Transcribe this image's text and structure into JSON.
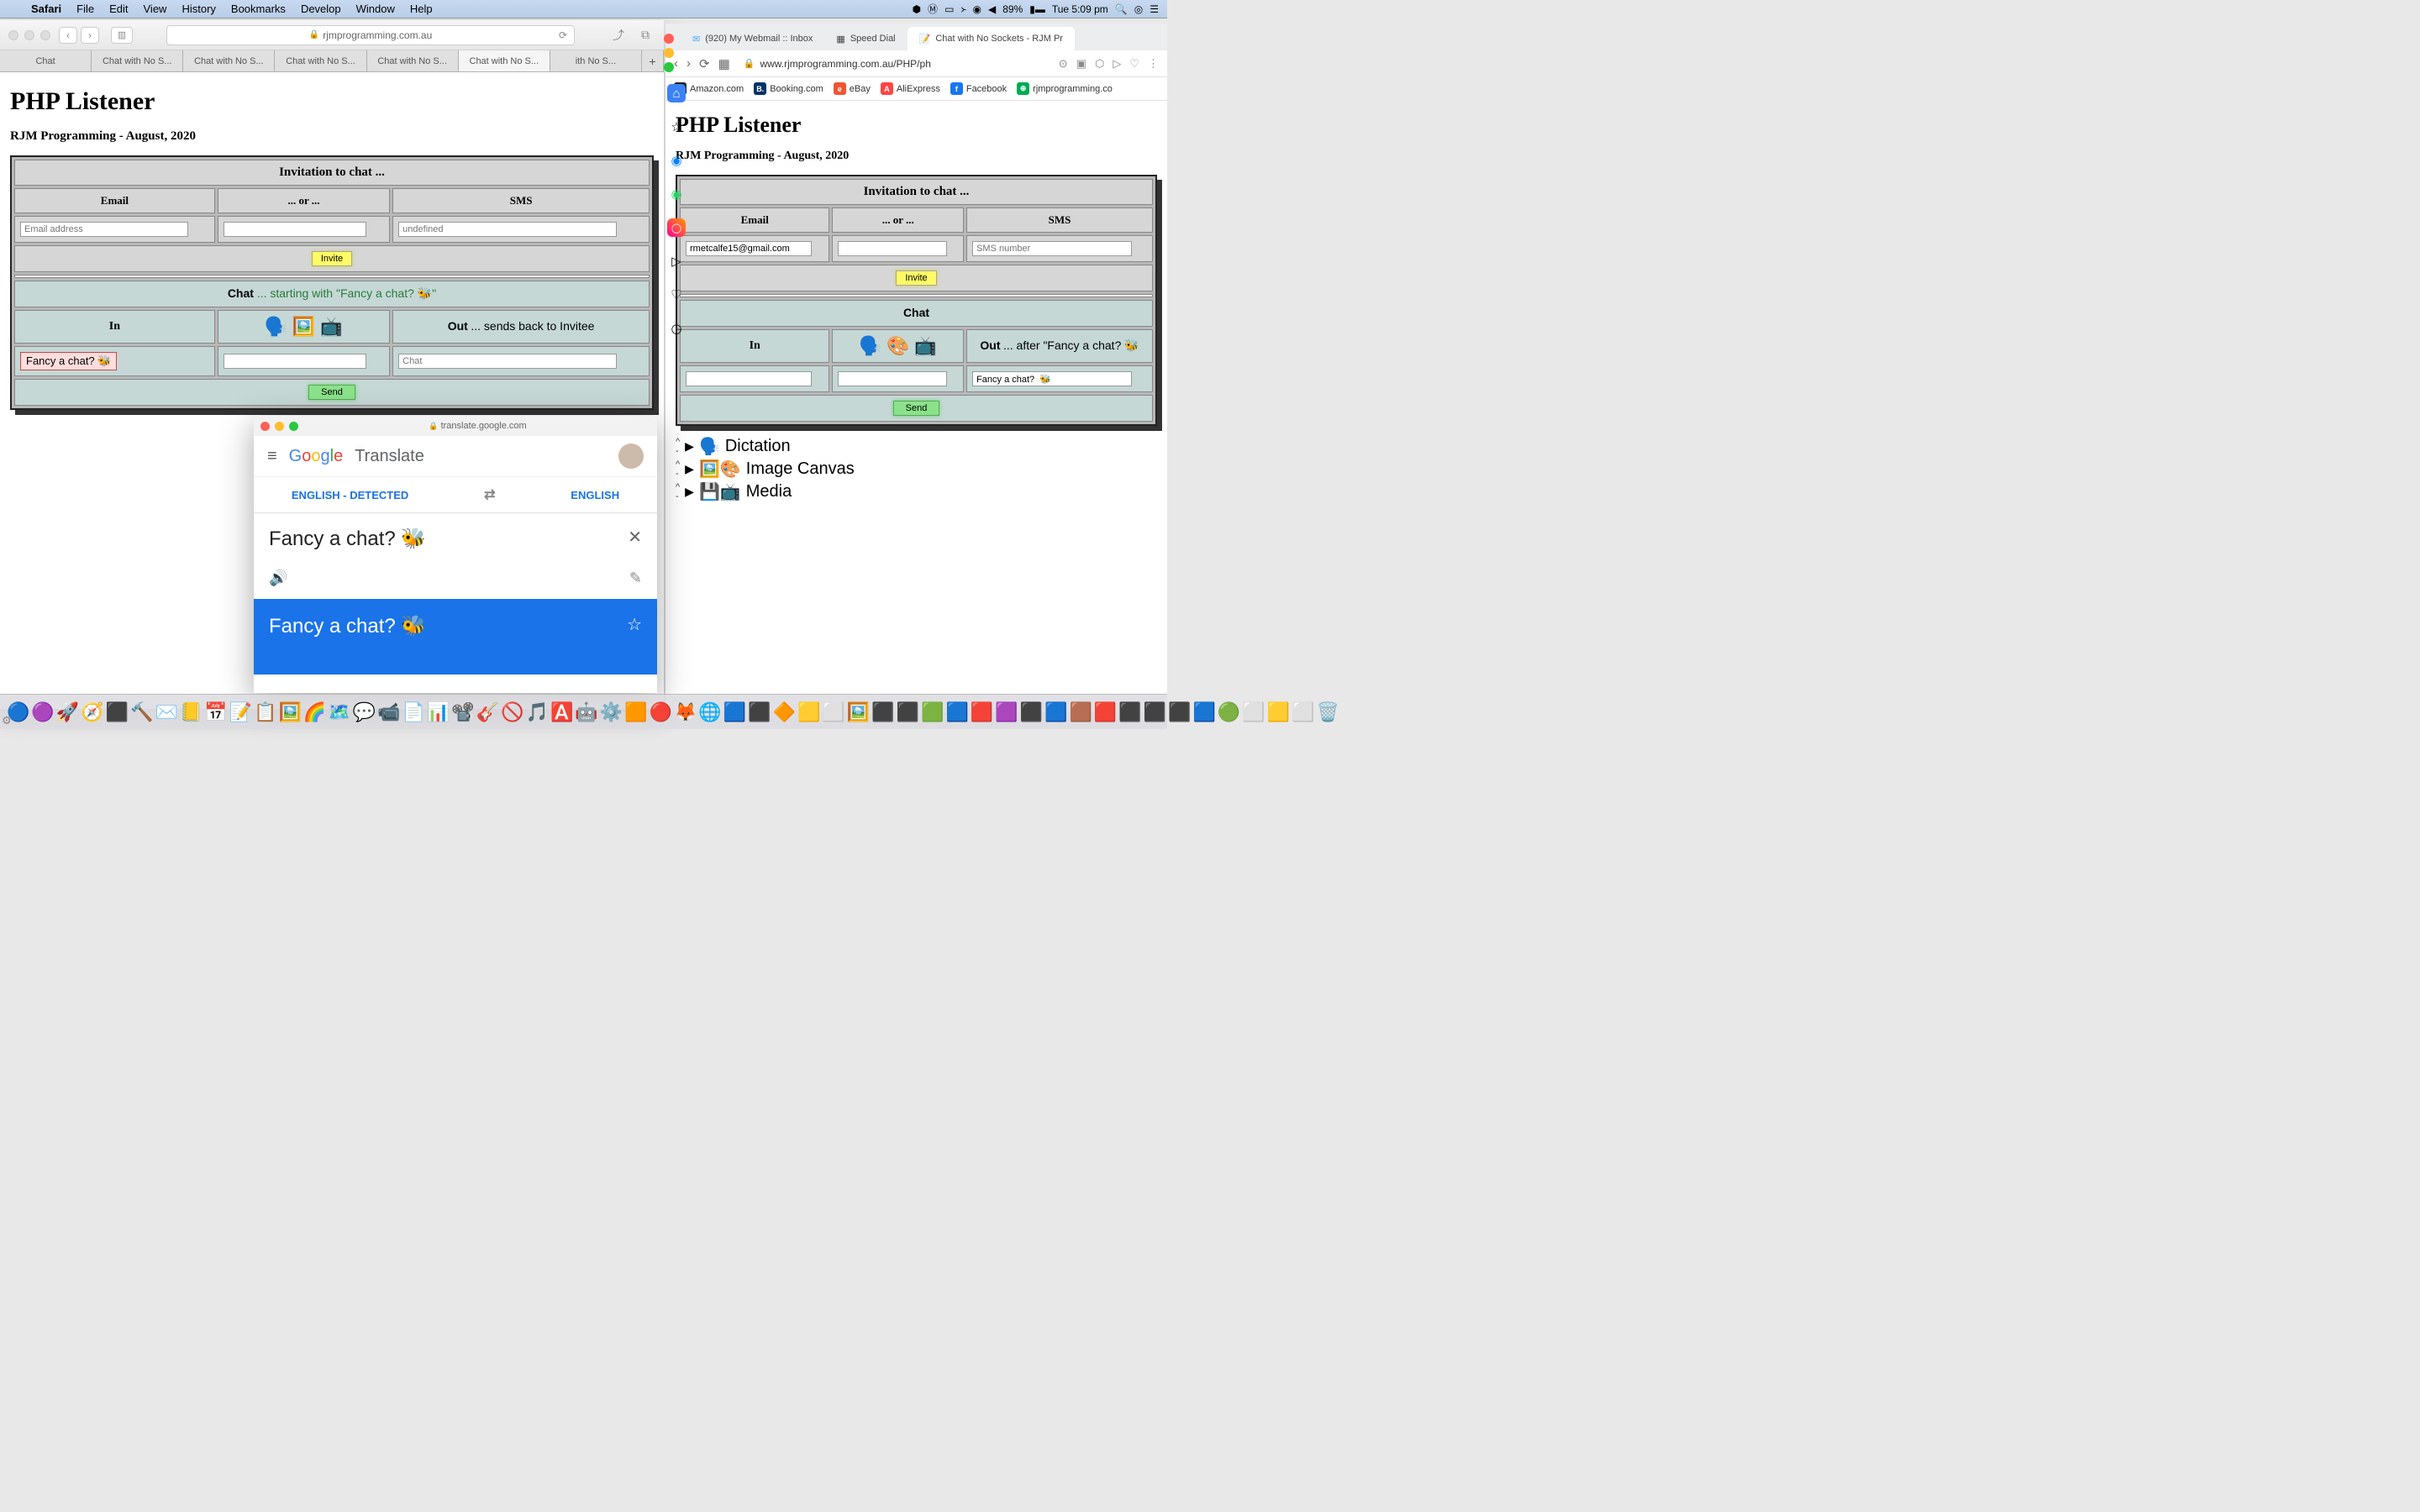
{
  "menubar": {
    "app": "Safari",
    "items": [
      "File",
      "Edit",
      "View",
      "History",
      "Bookmarks",
      "Develop",
      "Window",
      "Help"
    ],
    "battery": "89%",
    "clock": "Tue 5:09 pm"
  },
  "safari": {
    "address": "rjmprogramming.com.au",
    "tabs": [
      "Chat",
      "Chat with No S...",
      "Chat with No S...",
      "Chat with No S...",
      "Chat with No S...",
      "Chat with No S...",
      "ith No S..."
    ]
  },
  "page_left": {
    "h1": "PHP Listener",
    "h2": "RJM Programming - August, 2020",
    "invite_hdr": "Invitation to chat ...",
    "email": "Email",
    "or": "... or ...",
    "sms": "SMS",
    "email_ph": "Email address",
    "sms_ph": "undefined",
    "invite_btn": "Invite",
    "chat_lbl": "Chat",
    "chat_suffix": " ... starting with \"Fancy a chat? 🐝\"",
    "in": "In",
    "out": "Out",
    "out_suffix": " ... sends back to Invitee",
    "fancy": "Fancy a chat? 🐝",
    "chat_ph": "Chat",
    "send": "Send",
    "icons": "🗣️ 🖼️ 📺"
  },
  "browser2": {
    "tabs": [
      {
        "label": "(920) My Webmail :: Inbox",
        "icon": "✉"
      },
      {
        "label": "Speed Dial",
        "icon": "▦"
      },
      {
        "label": "Chat with No Sockets - RJM Pr",
        "icon": "📝"
      }
    ],
    "url": "www.rjmprogramming.com.au/PHP/ph",
    "bookmarks": [
      "Amazon.com",
      "Booking.com",
      "eBay",
      "AliExpress",
      "Facebook",
      "rjmprogramming.co"
    ]
  },
  "page_right": {
    "h1": "PHP Listener",
    "h2": "RJM Programming - August, 2020",
    "invite_hdr": "Invitation to chat ...",
    "email": "Email",
    "or": "... or ...",
    "sms": "SMS",
    "email_val": "rmetcalfe15@gmail.com",
    "sms_ph": "SMS number",
    "invite_btn": "Invite",
    "chat_lbl": "Chat",
    "in": "In",
    "out": "Out",
    "out_suffix": " ... after \"Fancy a chat? 🐝",
    "fancy": "Fancy a chat?  🐝",
    "send": "Send",
    "icons": "🗣️ 🎨 📺",
    "details": [
      {
        "icon": "🗣️",
        "label": "Dictation"
      },
      {
        "icon": "🖼️🎨",
        "label": "Image Canvas"
      },
      {
        "icon": "💾📺",
        "label": "Media"
      }
    ]
  },
  "translate": {
    "url": "translate.google.com",
    "brand": "Translate",
    "src_lang": "ENGLISH - DETECTED",
    "tgt_lang": "ENGLISH",
    "input": "Fancy a chat?  🐝",
    "output": "Fancy a chat?  🐝"
  }
}
